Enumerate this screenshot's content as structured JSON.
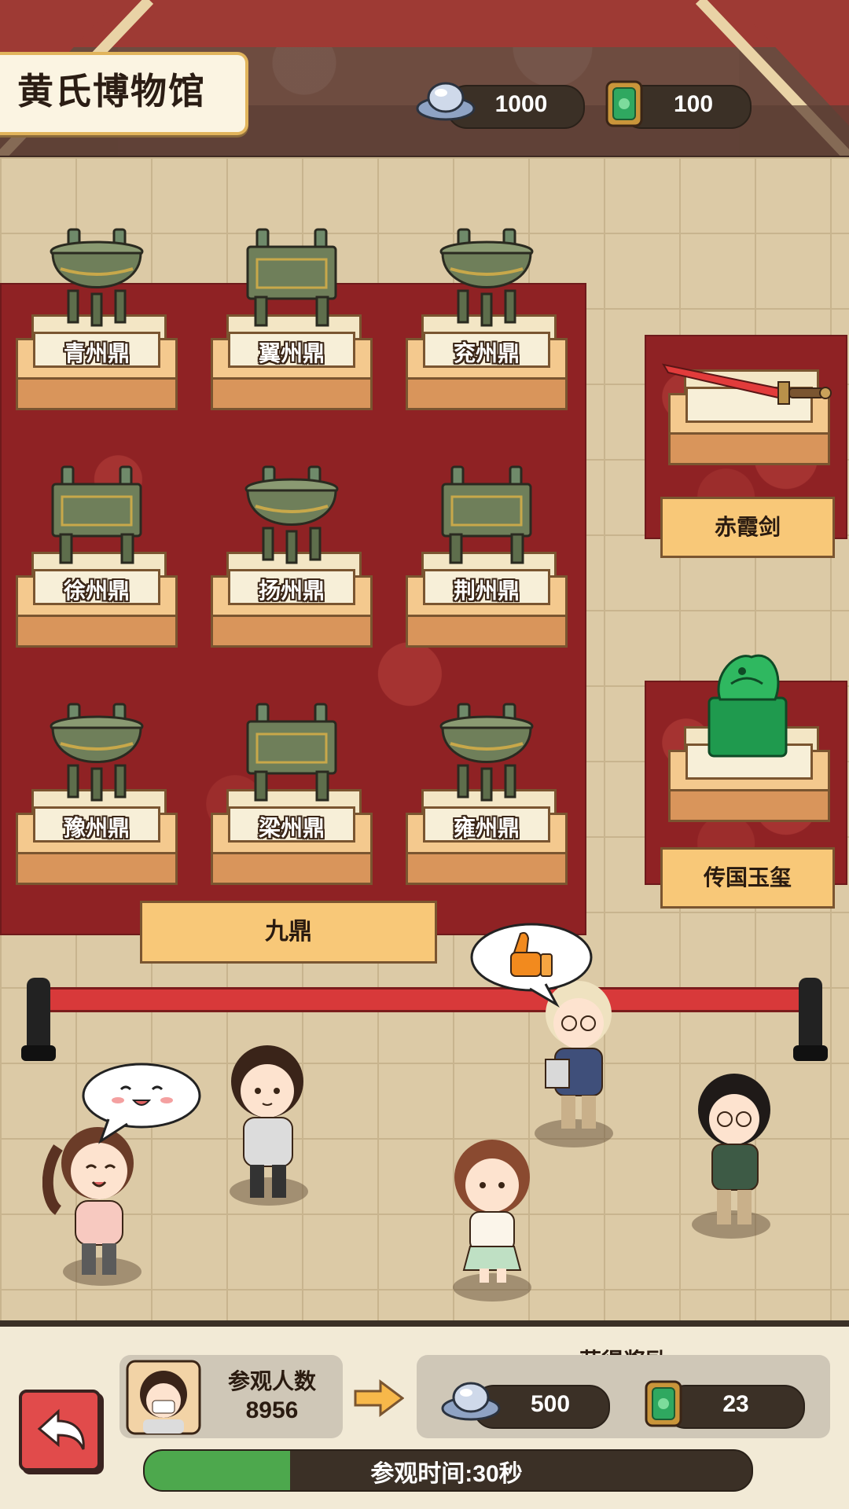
{
  "header": {
    "museum_name": "黄氏博物馆",
    "silver_count": "1000",
    "jade_count": "100"
  },
  "exhibits": {
    "group_label": "九鼎",
    "cauldrons": [
      {
        "name": "青州鼎"
      },
      {
        "name": "翼州鼎"
      },
      {
        "name": "兖州鼎"
      },
      {
        "name": "徐州鼎"
      },
      {
        "name": "扬州鼎"
      },
      {
        "name": "荆州鼎"
      },
      {
        "name": "豫州鼎"
      },
      {
        "name": "梁州鼎"
      },
      {
        "name": "雍州鼎"
      }
    ],
    "sword_label": "赤霞剑",
    "seal_label": "传国玉玺"
  },
  "bottom": {
    "visitor_label": "参观人数",
    "visitor_count": "8956",
    "reward_title": "获得奖励",
    "reward_silver": "500",
    "reward_jade": "23",
    "progress_text": "参观时间:30秒",
    "progress_fraction": 0.24
  },
  "colors": {
    "carpet": "#8f2224",
    "nameplate": "#f8c878",
    "progress": "#4da84d",
    "back_button": "#e14b4b"
  }
}
